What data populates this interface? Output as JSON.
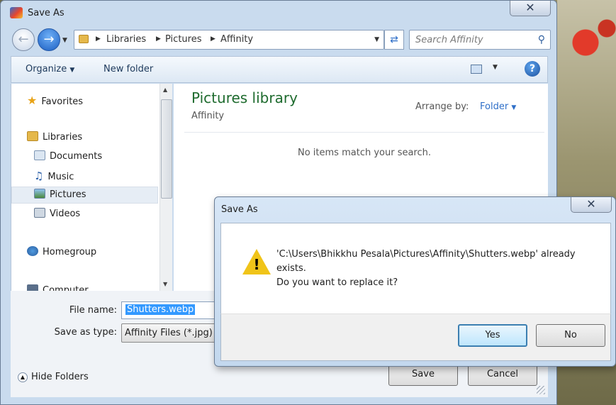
{
  "window": {
    "title": "Save As",
    "close_glyph": "✕"
  },
  "address_bar": {
    "crumbs": [
      "Libraries",
      "Pictures",
      "Affinity"
    ],
    "search_placeholder": "Search Affinity"
  },
  "toolbar": {
    "organize_label": "Organize",
    "new_folder_label": "New folder"
  },
  "nav": {
    "items": [
      {
        "label": "Favorites",
        "icon": "star-icon"
      },
      {
        "label": "Libraries",
        "icon": "libraries-icon"
      },
      {
        "label": "Documents",
        "icon": "documents-icon"
      },
      {
        "label": "Music",
        "icon": "music-icon"
      },
      {
        "label": "Pictures",
        "icon": "pictures-icon"
      },
      {
        "label": "Videos",
        "icon": "videos-icon"
      },
      {
        "label": "Homegroup",
        "icon": "homegroup-icon"
      },
      {
        "label": "Computer",
        "icon": "computer-icon"
      }
    ],
    "selected": "Pictures"
  },
  "content": {
    "library_title": "Pictures library",
    "library_subtitle": "Affinity",
    "arrange_label": "Arrange by:",
    "arrange_value": "Folder",
    "empty_message": "No items match your search."
  },
  "form": {
    "file_name_label": "File name:",
    "file_name_value": "Shutters.webp",
    "save_type_label": "Save as type:",
    "save_type_value": "Affinity Files (*.jpg)",
    "hide_folders_label": "Hide Folders",
    "save_label": "Save",
    "cancel_label": "Cancel"
  },
  "dialog": {
    "title": "Save As",
    "message_line1": "'C:\\Users\\Bhikkhu Pesala\\Pictures\\Affinity\\Shutters.webp' already",
    "message_line2": "exists.",
    "message_line3": "Do you want to replace it?",
    "yes_label": "Yes",
    "no_label": "No",
    "icon": "warning-icon"
  },
  "colors": {
    "library_title": "#1e6b2e",
    "link_blue": "#2f6fc8",
    "selection": "#3399ff",
    "warning": "#f0c419"
  }
}
